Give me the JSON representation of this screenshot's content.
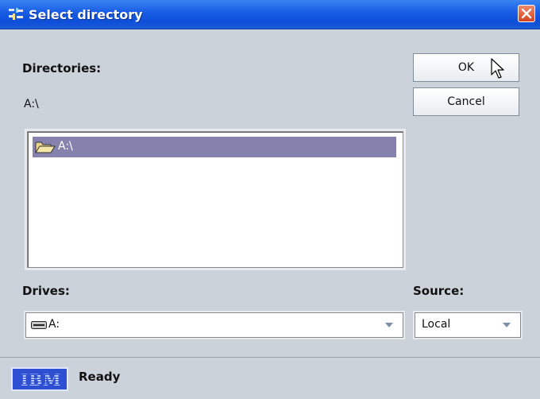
{
  "window": {
    "title": "Select directory",
    "app_icon": "tool-icon",
    "close_icon": "close-icon"
  },
  "directories": {
    "label": "Directories:",
    "current_path": "A:\\"
  },
  "buttons": {
    "ok": "OK",
    "cancel": "Cancel"
  },
  "directory_list": {
    "items": [
      {
        "icon": "open-folder-icon",
        "label": "A:\\",
        "selected": true
      }
    ]
  },
  "drives": {
    "label": "Drives:",
    "selected": "A:",
    "icon": "drive-icon"
  },
  "source": {
    "label": "Source:",
    "selected": "Local"
  },
  "status": {
    "logo": "IBM",
    "text": "Ready"
  },
  "colors": {
    "title_bar": "#1a5fe6",
    "selection": "#8582ae",
    "panel": "#ccd2d9"
  }
}
